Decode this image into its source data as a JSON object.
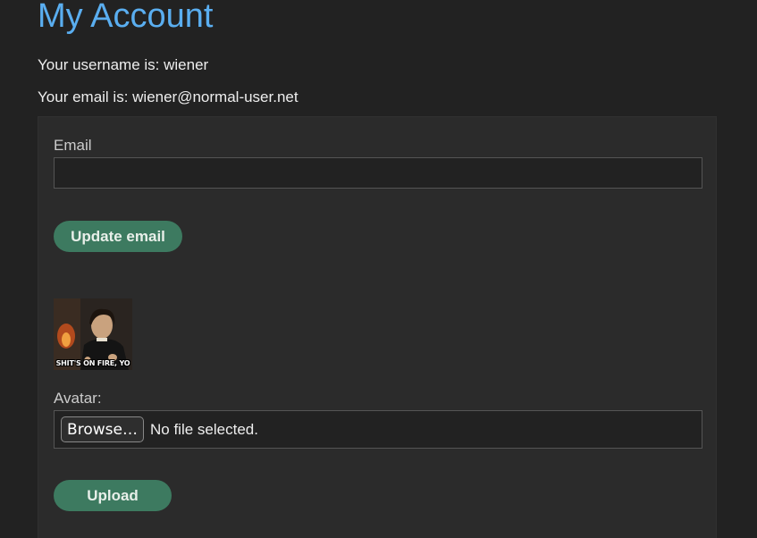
{
  "page": {
    "title": "My Account",
    "username_text": "Your username is: wiener",
    "email_text": "Your email is: wiener@normal-user.net"
  },
  "email_form": {
    "label": "Email",
    "input_value": "",
    "submit_label": "Update email"
  },
  "avatar": {
    "caption": "SHIT'S ON FIRE, YO"
  },
  "avatar_form": {
    "label": "Avatar:",
    "browse_label": "Browse…",
    "file_status": "No file selected.",
    "submit_label": "Upload"
  },
  "colors": {
    "background": "#222222",
    "panel": "#2b2b2b",
    "title": "#5aaef0",
    "button": "#3d7a60"
  }
}
